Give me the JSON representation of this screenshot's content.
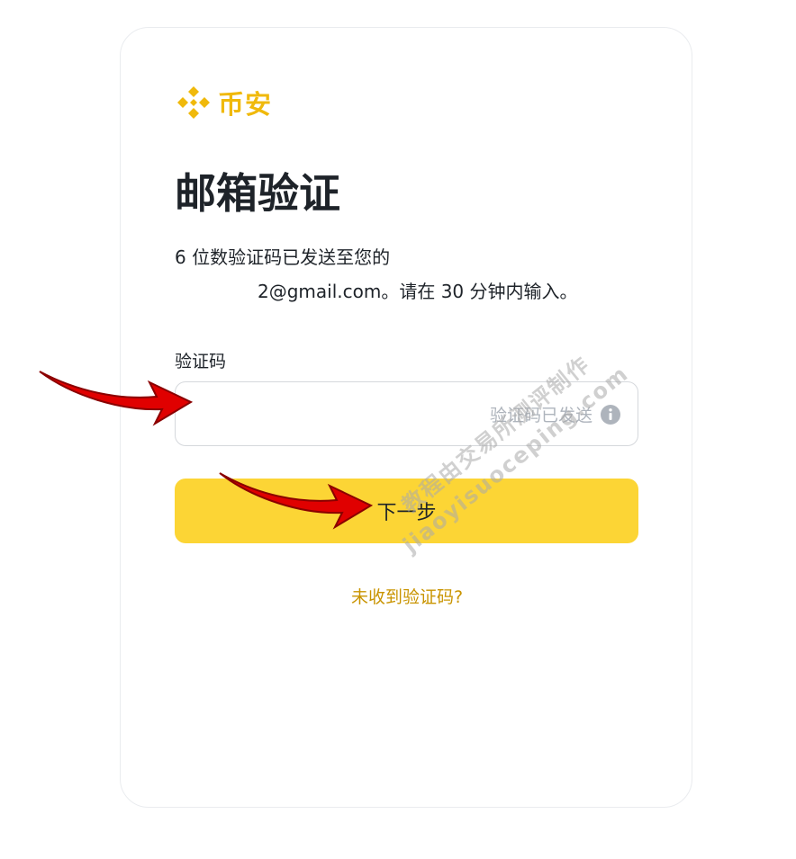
{
  "brand": {
    "name": "币安",
    "color": "#F0B90B"
  },
  "page": {
    "title": "邮箱验证"
  },
  "description": {
    "line1": "6 位数验证码已发送至您的",
    "email_visible": "2@gmail.com",
    "line2_suffix": "。请在 30 分钟内输入。"
  },
  "form": {
    "code_label": "验证码",
    "code_value": "",
    "sent_hint": "验证码已发送",
    "info_icon": "info-icon"
  },
  "actions": {
    "next_label": "下一步",
    "resend_label": "未收到验证码?"
  },
  "watermark": {
    "line1": "教程由交易所测评制作",
    "line2": "jiaoyisuoceping.com"
  },
  "colors": {
    "accent": "#FCD535",
    "link": "#C99400",
    "annotation_arrow": "#E00000"
  }
}
